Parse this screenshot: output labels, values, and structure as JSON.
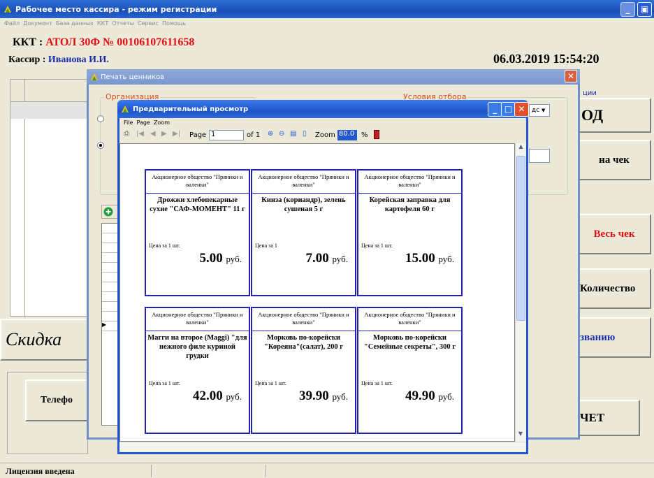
{
  "main": {
    "title": "Рабочее место кассира - режим регистрации",
    "menu": [
      "Файл",
      "Документ",
      "База данных",
      "ККТ",
      "Отчеты",
      "Сервис",
      "Помощь"
    ],
    "kkt_label": "ККТ :",
    "kkt_value": "АТОЛ 30Ф  № 00106107611658",
    "cashier_label": "Кассир :",
    "cashier_value": "Иванова И.И.",
    "datetime": "06.03.2019  15:54:20",
    "right_label": "ции",
    "btn_od": "ОД",
    "btn_na_chek": "на чек",
    "btn_ves_chek": "Весь чек",
    "btn_kolichestvo": "Количество",
    "btn_zvaniyu": "званию",
    "btn_chet": "ЧЕТ",
    "discount": "Скидка",
    "phone_btn": "Телефо",
    "status": "Лицензия введена"
  },
  "dialog": {
    "title": "Печать ценников",
    "org_group": "Организация",
    "filter_group": "Условия отбора",
    "combo_text": "дс"
  },
  "preview": {
    "title": "Предварительный просмотр",
    "menu": [
      "File",
      "Page",
      "Zoom"
    ],
    "page_label": "Page",
    "page_value": "1",
    "page_of": "of 1",
    "zoom_label": "Zoom",
    "zoom_value": "80.0",
    "zoom_unit": "%"
  },
  "tags": [
    {
      "org": "Акционерное общество \"Пряники и валенки\"",
      "name": "Дрожжи хлебопекарные сухие \"САФ-МОМЕНТ\" 11 г",
      "price_label": "Цена за 1 шт.",
      "price": "5.00",
      "currency": "руб."
    },
    {
      "org": "Акционерное общество \"Пряники и валенки\"",
      "name": "Кинза (кориандр), зелень сушеная 5 г",
      "price_label": "Цена за 1",
      "price": "7.00",
      "currency": "руб."
    },
    {
      "org": "Акционерное общество \"Пряники и валенки\"",
      "name": "Корейская заправка для картофеля 60 г",
      "price_label": "Цена за 1 шт.",
      "price": "15.00",
      "currency": "руб."
    },
    {
      "org": "Акционерное общество \"Пряники и валенки\"",
      "name": "Магги на второе (Maggi) \"для нежного филе куриной грудки",
      "price_label": "Цена за 1 шт.",
      "price": "42.00",
      "currency": "руб."
    },
    {
      "org": "Акционерное общество \"Пряники и валенки\"",
      "name": "Морковь по-корейски \"Кореяна\"(салат), 200 г",
      "price_label": "Цена за 1 шт.",
      "price": "39.90",
      "currency": "руб."
    },
    {
      "org": "Акционерное общество \"Пряники и валенки\"",
      "name": "Морковь по-корейски \"Семейные секреты\", 300 г",
      "price_label": "Цена за 1 шт.",
      "price": "49.90",
      "currency": "руб."
    }
  ],
  "colors": {
    "kkt": "#e01010",
    "cashier": "#1a2ea8",
    "ves_chek": "#e01010",
    "zvaniyu": "#1a2ea8",
    "tag_border": "#2222aa",
    "titlebar": "#1f55cc"
  },
  "icons": [
    "app-icon",
    "minimize-icon",
    "maximize-icon",
    "close-icon",
    "print-icon",
    "first-page-icon",
    "prev-page-icon",
    "next-page-icon",
    "last-page-icon",
    "zoom-in-icon",
    "zoom-out-icon",
    "page-width-icon",
    "whole-page-icon",
    "exit-icon",
    "add-icon"
  ]
}
